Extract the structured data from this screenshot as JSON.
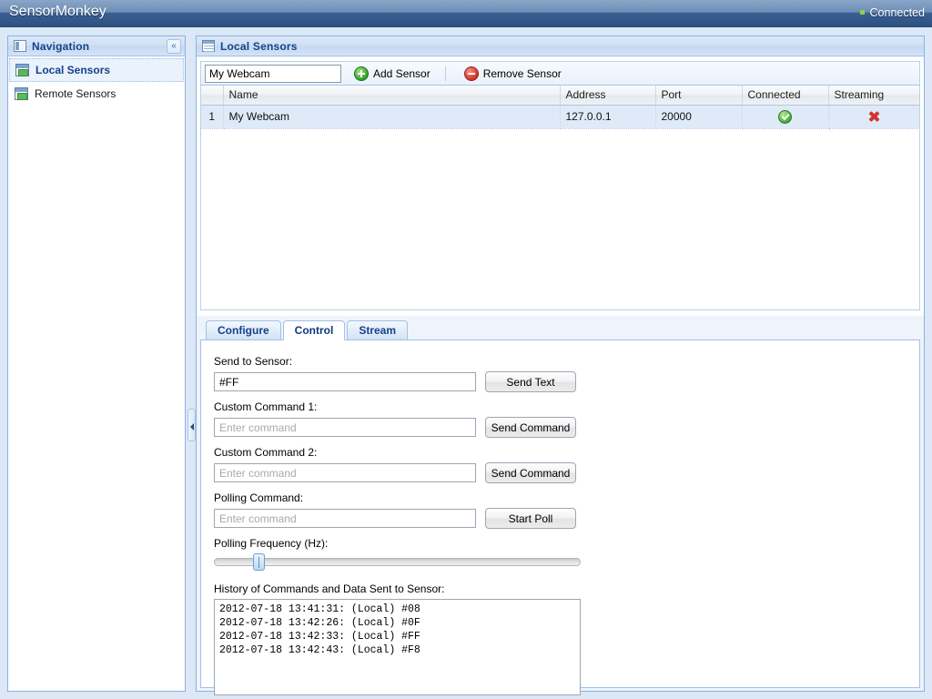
{
  "titlebar": {
    "app_title": "SensorMonkey",
    "connection_status": "Connected",
    "status_color": "#8fd14f"
  },
  "navigation": {
    "header_title": "Navigation",
    "collapse_label": "«",
    "items": [
      {
        "label": "Local Sensors",
        "selected": true
      },
      {
        "label": "Remote Sensors",
        "selected": false
      }
    ]
  },
  "main": {
    "header_title": "Local Sensors",
    "toolbar": {
      "sensor_name_value": "My Webcam",
      "add_label": "Add Sensor",
      "remove_label": "Remove Sensor"
    },
    "grid": {
      "columns": [
        "",
        "Name",
        "Address",
        "Port",
        "Connected",
        "Streaming"
      ],
      "rows": [
        {
          "num": "1",
          "name": "My Webcam",
          "address": "127.0.0.1",
          "port": "20000",
          "connected": "check",
          "streaming": "cross"
        }
      ]
    },
    "tabs": [
      {
        "label": "Configure",
        "active": false
      },
      {
        "label": "Control",
        "active": true
      },
      {
        "label": "Stream",
        "active": false
      }
    ],
    "control": {
      "send_to_sensor_label": "Send to Sensor:",
      "send_to_sensor_value": "#FF",
      "send_text_button": "Send Text",
      "custom_command_1_label": "Custom Command 1:",
      "custom_command_1_placeholder": "Enter command",
      "custom_command_1_value": "",
      "send_command_1_button": "Send Command",
      "custom_command_2_label": "Custom Command 2:",
      "custom_command_2_placeholder": "Enter command",
      "custom_command_2_value": "",
      "send_command_2_button": "Send Command",
      "polling_command_label": "Polling Command:",
      "polling_command_placeholder": "Enter command",
      "polling_command_value": "",
      "start_poll_button": "Start Poll",
      "polling_frequency_label": "Polling Frequency (Hz):",
      "polling_frequency_percent": 11,
      "history_label": "History of Commands and Data Sent to Sensor:",
      "history_lines": [
        "2012-07-18 13:41:31: (Local) #08",
        "2012-07-18 13:42:26: (Local) #0F",
        "2012-07-18 13:42:33: (Local) #FF",
        "2012-07-18 13:42:43: (Local) #F8"
      ]
    }
  }
}
